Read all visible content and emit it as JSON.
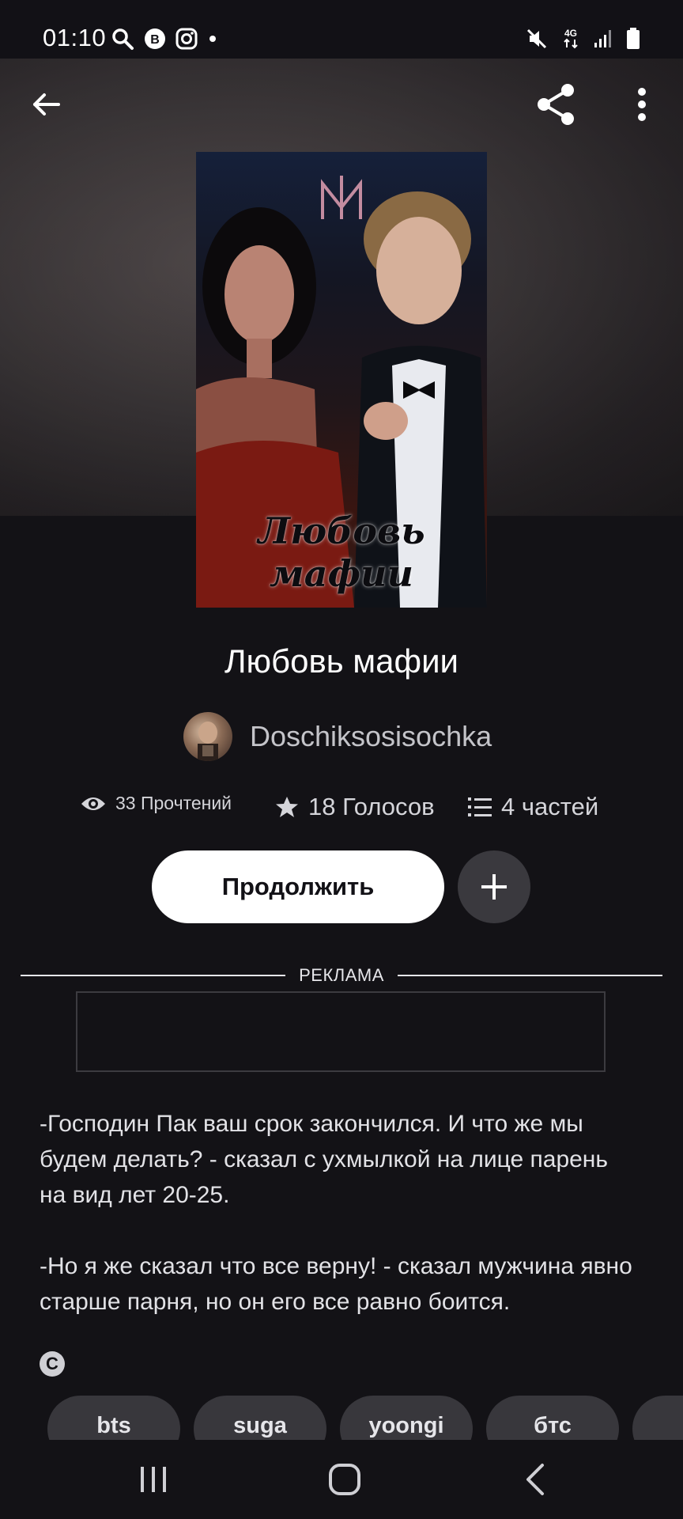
{
  "status_bar": {
    "time": "01:10",
    "network": "4G"
  },
  "story": {
    "title": "Любовь мафии",
    "cover_title": "Любовь мафии",
    "author": "Doschiksosisochka",
    "reads": "33 Прочтений",
    "votes": "18 Голосов",
    "parts": "4 частей"
  },
  "actions": {
    "continue_label": "Продолжить"
  },
  "ad": {
    "label": "РЕКЛАМА"
  },
  "excerpt": {
    "paragraph1": "-Господин Пак ваш срок закончился. И что же мы будем делать? - сказал с ухмылкой на лице парень на вид лет 20-25.",
    "paragraph2": "-Но я же сказал что все верну! - сказал мужчина явно старше парня, но он его все равно боится."
  },
  "copyright_symbol": "C",
  "tags": [
    "bts",
    "suga",
    "yoongi",
    "бтс"
  ],
  "icons": {
    "back": "arrow-left-icon",
    "share": "share-icon",
    "more": "more-vertical-icon",
    "reads": "eye-icon",
    "votes": "star-icon",
    "parts": "list-icon",
    "add": "plus-icon"
  }
}
